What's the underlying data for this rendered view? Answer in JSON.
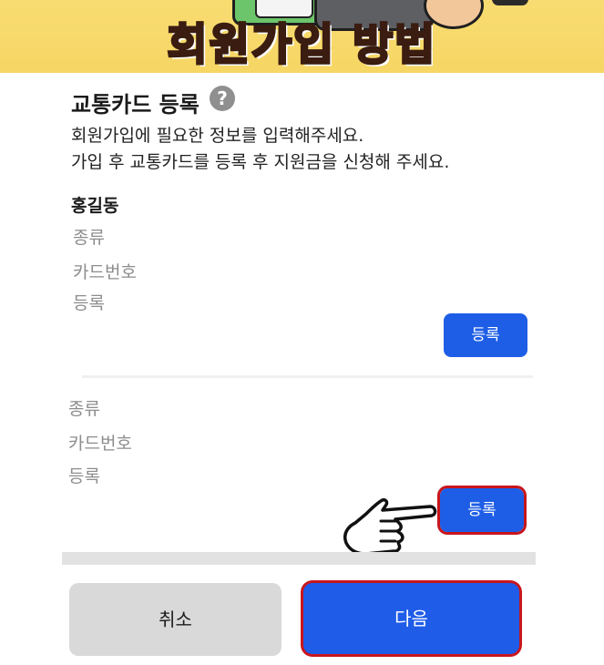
{
  "banner": {
    "title": "회원가입 방법"
  },
  "card": {
    "title": "교통카드 등록",
    "help_icon": "question-mark-icon",
    "desc_line1": "회원가입에 필요한 정보를 입력해주세요.",
    "desc_line2": "가입 후 교통카드를 등록 후 지원금을 신청해 주세요."
  },
  "owner_name": "홍길동",
  "cards": [
    {
      "type_label": "종류",
      "number_label": "카드번호",
      "register_label": "등록",
      "button_label": "등록"
    },
    {
      "type_label": "종류",
      "number_label": "카드번호",
      "register_label": "등록",
      "button_label": "등록"
    }
  ],
  "footer": {
    "cancel_label": "취소",
    "next_label": "다음"
  },
  "colors": {
    "primary": "#1e5ee6",
    "highlight": "#c8161d",
    "banner": "#f7d96a"
  },
  "pointer_icon": "pointing-hand-icon"
}
